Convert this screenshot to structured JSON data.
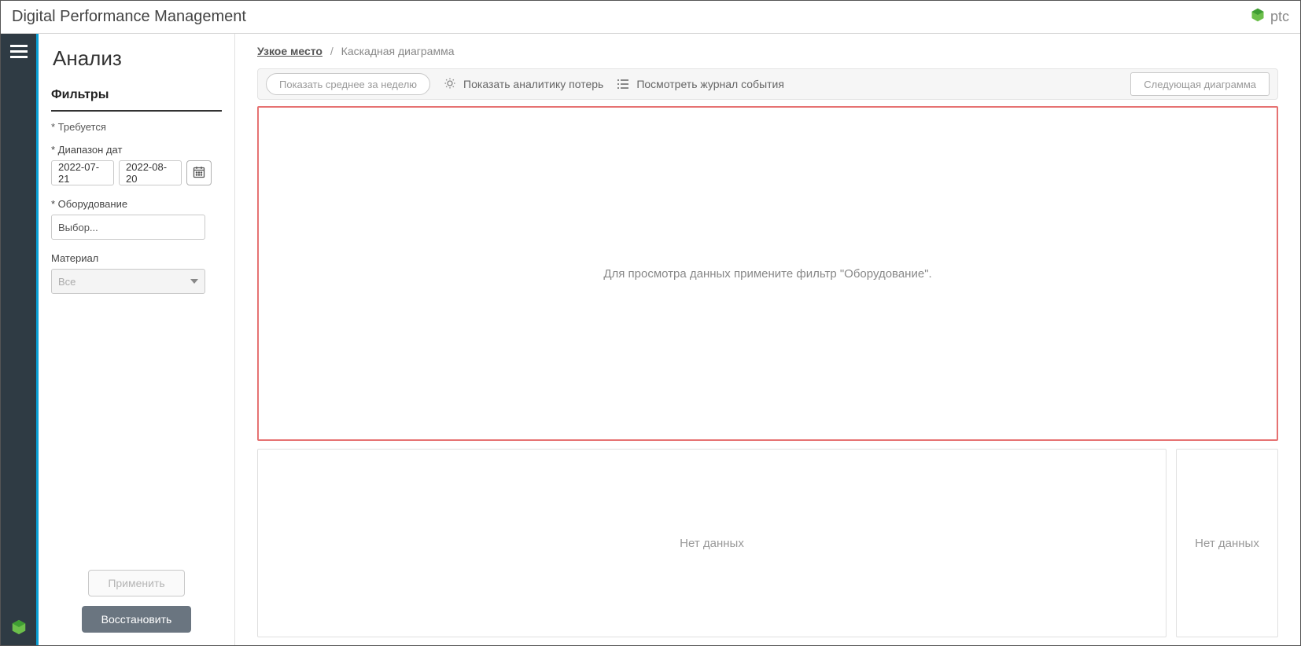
{
  "header": {
    "title": "Digital Performance Management",
    "logo_text": "ptc"
  },
  "sidebar": {
    "page_title": "Анализ",
    "filters_title": "Фильтры",
    "required_note": "* Требуется",
    "date_range_label": "* Диапазон дат",
    "date_from": "2022-07-21",
    "date_to": "2022-08-20",
    "equipment_label": "* Оборудование",
    "equipment_placeholder": "Выбор...",
    "material_label": "Материал",
    "material_value": "Все",
    "apply_label": "Применить",
    "restore_label": "Восстановить"
  },
  "breadcrumb": {
    "root": "Узкое место",
    "current": "Каскадная диаграмма"
  },
  "toolbar": {
    "weekly_avg": "Показать среднее за неделю",
    "loss_analytics": "Показать аналитику потерь",
    "event_log": "Посмотреть журнал события",
    "next_chart": "Следующая диаграмма"
  },
  "chart": {
    "empty_message": "Для просмотра данных примените фильтр \"Оборудование\"."
  },
  "panels": {
    "left_empty": "Нет данных",
    "right_empty": "Нет данных"
  }
}
